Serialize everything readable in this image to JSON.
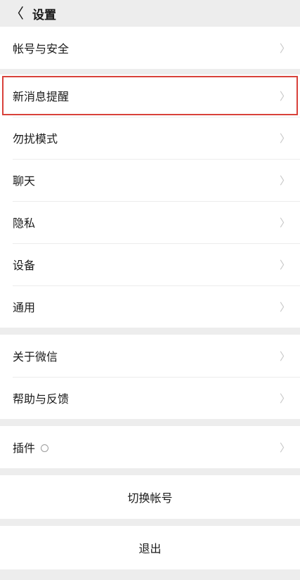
{
  "header": {
    "back_glyph": "〈",
    "title": "设置"
  },
  "groups": [
    {
      "items": [
        {
          "label": "帐号与安全"
        }
      ]
    },
    {
      "items": [
        {
          "label": "新消息提醒",
          "highlighted": true
        },
        {
          "label": "勿扰模式"
        },
        {
          "label": "聊天"
        },
        {
          "label": "隐私"
        },
        {
          "label": "设备"
        },
        {
          "label": "通用"
        }
      ]
    },
    {
      "items": [
        {
          "label": "关于微信"
        },
        {
          "label": "帮助与反馈"
        }
      ]
    },
    {
      "items": [
        {
          "label": "插件"
        }
      ]
    }
  ],
  "buttons": {
    "switch_account": "切换帐号",
    "logout": "退出"
  },
  "icons": {
    "chevron": "〉"
  },
  "colors": {
    "background": "#ededed",
    "highlight_border": "#d8413a"
  }
}
